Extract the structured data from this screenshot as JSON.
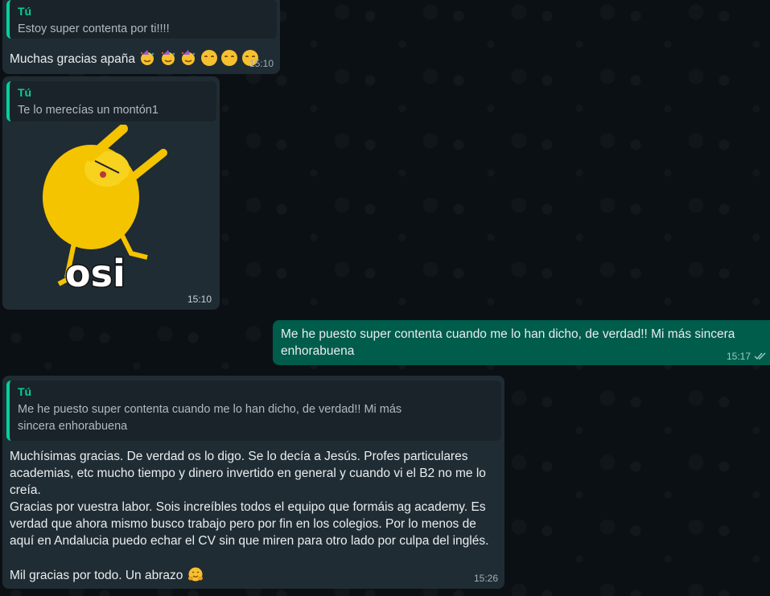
{
  "colors": {
    "background": "#0b1014",
    "incoming_bubble": "#202c33",
    "outgoing_bubble": "#005c4b",
    "quote_accent": "#06cf9c"
  },
  "messages": [
    {
      "direction": "incoming",
      "quote": {
        "author": "Tú",
        "text": "Estoy super contenta por ti!!!!"
      },
      "text": "Muchas gracias apaña",
      "emojis": [
        "partying-face",
        "partying-face",
        "partying-face",
        "smiling-face",
        "smiling-face",
        "smiling-face"
      ],
      "time": "15:10"
    },
    {
      "direction": "incoming",
      "quote": {
        "author": "Tú",
        "text": "Te lo merecías un montón1"
      },
      "sticker": {
        "name": "dabbing-dog-sticker",
        "caption": "osi"
      },
      "time": "15:10"
    },
    {
      "direction": "outgoing",
      "text": "Me he puesto super contenta cuando me lo han dicho, de verdad!! Mi más sincera enhorabuena",
      "time": "15:17",
      "status_icon": "double-check-icon"
    },
    {
      "direction": "incoming",
      "quote": {
        "author": "Tú",
        "text": "Me he puesto super contenta cuando me lo han dicho, de verdad!! Mi más sincera enhorabuena"
      },
      "text": "Muchísimas gracias. De verdad os lo digo. Se lo decía a Jesús. Profes particulares academias, etc mucho tiempo y dinero invertido en general y cuando vi el B2 no me lo creía.\nGracias por vuestra labor. Sois increíbles todos el equipo que formáis ag academy. Es verdad que ahora mismo busco trabajo pero por fin en los colegios. Por lo menos de aquí en Andalucia puedo echar el CV sin que miren para otro lado por culpa del inglés.\n\nMil gracias por todo. Un abrazo",
      "emojis": [
        "hugging-face"
      ],
      "time": "15:26"
    }
  ]
}
